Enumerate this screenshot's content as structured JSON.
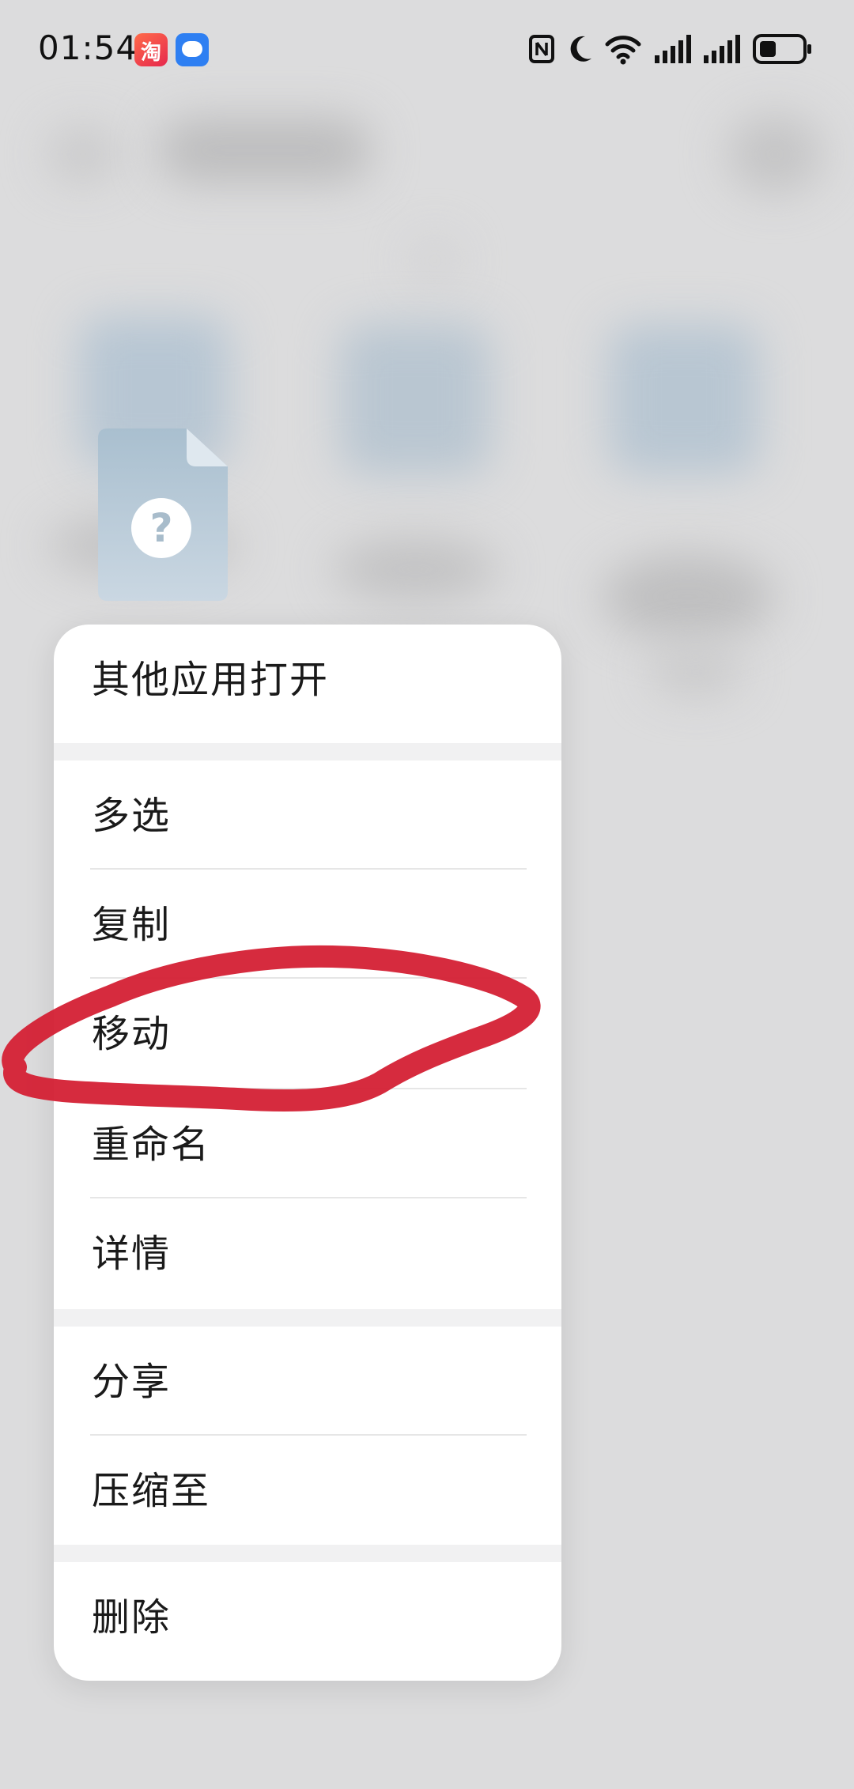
{
  "status_bar": {
    "time": "01:54",
    "notification_apps": [
      "taobao-icon",
      "messages-icon"
    ],
    "taobao_glyph": "淘",
    "system_icons": [
      "nfc-icon",
      "moon-icon",
      "wifi-icon",
      "signal-icon",
      "signal-icon",
      "battery-icon"
    ]
  },
  "file": {
    "icon": "unknown-file-icon",
    "glyph": "?"
  },
  "menu": {
    "items": [
      {
        "label": "其他应用打开"
      },
      {
        "label": "多选"
      },
      {
        "label": "复制"
      },
      {
        "label": "移动"
      },
      {
        "label": "重命名"
      },
      {
        "label": "详情"
      },
      {
        "label": "分享"
      },
      {
        "label": "压缩至"
      },
      {
        "label": "删除"
      }
    ]
  },
  "annotation": {
    "color": "#d42034",
    "highlights": "移动"
  }
}
